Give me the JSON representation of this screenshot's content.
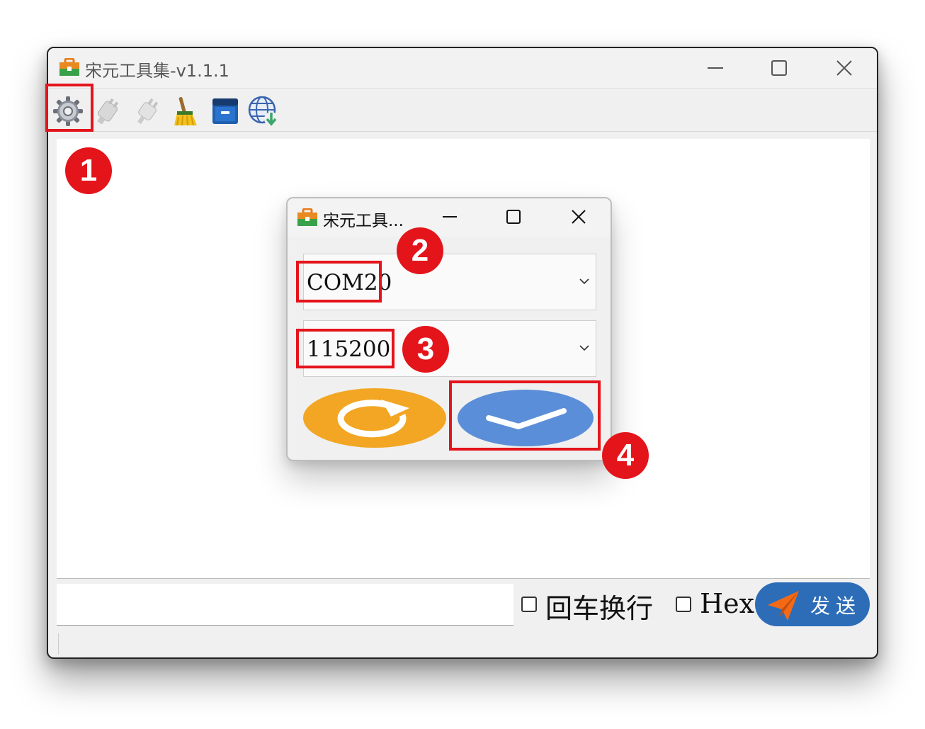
{
  "window": {
    "title": "宋元工具集-v1.1.1",
    "minimize_icon": "minimize-icon",
    "maximize_icon": "maximize-icon",
    "close_icon": "close-icon"
  },
  "toolbar": {
    "items": [
      {
        "name": "settings",
        "icon": "gear-icon"
      },
      {
        "name": "connect",
        "icon": "plug-icon"
      },
      {
        "name": "disconnect",
        "icon": "plug-icon"
      },
      {
        "name": "clear",
        "icon": "broom-icon"
      },
      {
        "name": "save",
        "icon": "archive-icon"
      },
      {
        "name": "download",
        "icon": "globe-download-icon"
      }
    ]
  },
  "send_bar": {
    "input_value": "",
    "newline_label": "回车换行",
    "newline_checked": false,
    "hex_label": "Hex",
    "hex_checked": false,
    "send_label": "发送",
    "send_icon": "paper-plane-icon"
  },
  "dialog": {
    "title": "宋元工具...",
    "port_value": "COM20",
    "baud_value": "115200",
    "refresh_icon": "refresh-icon",
    "confirm_icon": "checkmark-icon"
  },
  "annotations": {
    "badges": [
      "1",
      "2",
      "3",
      "4"
    ]
  },
  "colors": {
    "highlight": "#e4141b",
    "send_button": "#2d6db8",
    "refresh_button": "#f2a623",
    "confirm_button": "#5b8ed8"
  }
}
